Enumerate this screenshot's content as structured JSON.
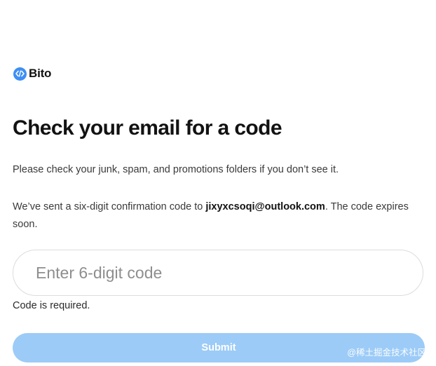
{
  "brand": {
    "logo_text": "Bito",
    "logo_icon": "code-brackets-icon",
    "accent": "#3d8ff5"
  },
  "page": {
    "title": "Check your email for a code",
    "hint": "Please check your junk, spam, and promotions folders if you don’t see it.",
    "sent_prefix": "We’ve sent a six-digit confirmation code to ",
    "email": "jixyxcsoqi@outlook.com",
    "sent_suffix": ". The code expires soon."
  },
  "form": {
    "code_value": "",
    "code_placeholder": "Enter 6-digit code",
    "error_text": "Code is required.",
    "submit_label": "Submit",
    "submit_color": "#9ccbf7"
  },
  "overlay": {
    "watermark": "@稀土掘金技术社区"
  }
}
